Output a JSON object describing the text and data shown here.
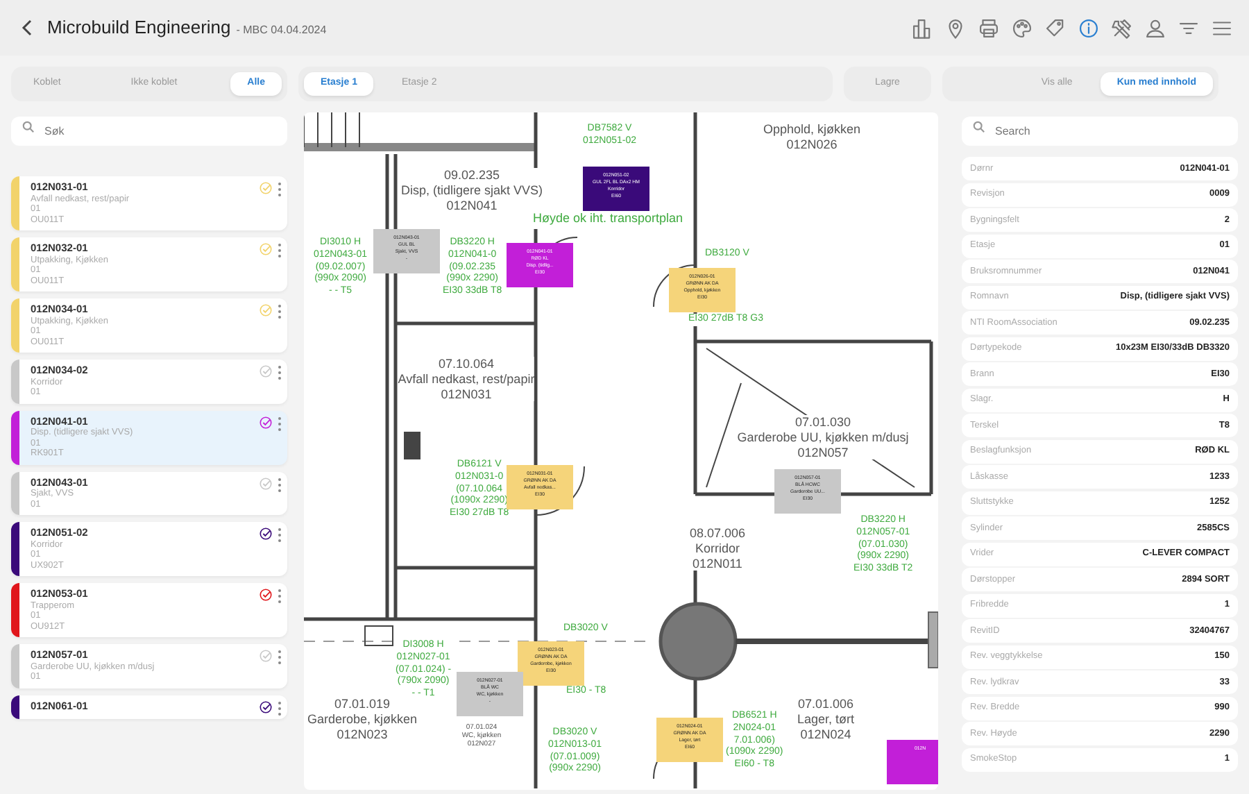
{
  "header": {
    "title": "Microbuild Engineering",
    "subtitle": "- MBC 04.04.2024"
  },
  "toolbar": [
    {
      "kind": "chart",
      "selected": false
    },
    {
      "kind": "pin",
      "selected": false
    },
    {
      "kind": "printer",
      "selected": false
    },
    {
      "kind": "palette",
      "selected": false
    },
    {
      "kind": "tag",
      "selected": false
    },
    {
      "kind": "info",
      "selected": true
    },
    {
      "kind": "tools",
      "selected": false
    },
    {
      "kind": "person",
      "selected": false
    },
    {
      "kind": "filter",
      "selected": false
    },
    {
      "kind": "menu",
      "selected": false
    }
  ],
  "link_filter": [
    {
      "label": "Koblet",
      "selected": false
    },
    {
      "label": "Ikke koblet",
      "selected": false
    },
    {
      "label": "Alle",
      "selected": true
    }
  ],
  "floors": [
    {
      "label": "Etasje 1",
      "selected": true
    },
    {
      "label": "Etasje 2",
      "selected": false
    }
  ],
  "save_button": "Lagre",
  "content_filter": [
    {
      "label": "Vis alle",
      "selected": false
    },
    {
      "label": "Kun med innhold",
      "selected": true
    }
  ],
  "door_list": {
    "search_placeholder": "Søk",
    "items": [
      {
        "id": "012N031-01",
        "name": "Avfall nedkast, rest/papir",
        "floor": "01",
        "code": "OU011T",
        "color": "#f2d36b",
        "selected": false
      },
      {
        "id": "012N032-01",
        "name": "Utpakking, Kjøkken",
        "floor": "01",
        "code": "OU011T",
        "color": "#f2d36b",
        "selected": false
      },
      {
        "id": "012N034-01",
        "name": "Utpakking, Kjøkken",
        "floor": "01",
        "code": "OU011T",
        "color": "#f2d36b",
        "selected": false
      },
      {
        "id": "012N034-02",
        "name": "Korridor",
        "floor": "01",
        "color": "#c8c8c8",
        "selected": false
      },
      {
        "id": "012N041-01",
        "name": "Disp. (tidligere sjakt VVS)",
        "floor": "01",
        "code": "RK901T",
        "color": "#c21fd8",
        "selected": true
      },
      {
        "id": "012N043-01",
        "name": "Sjakt, VVS",
        "floor": "01",
        "color": "#c8c8c8",
        "selected": false
      },
      {
        "id": "012N051-02",
        "name": "Korridor",
        "floor": "01",
        "code": "UX902T",
        "color": "#3a0a7a",
        "selected": false
      },
      {
        "id": "012N053-01",
        "name": "Trapperom",
        "floor": "01",
        "code": "OU912T",
        "color": "#e0161b",
        "selected": false
      },
      {
        "id": "012N057-01",
        "name": "Garderobe UU, kjøkken m/dusj",
        "floor": "01",
        "color": "#c8c8c8",
        "selected": false
      },
      {
        "id": "012N061-01",
        "color": "#3a0a7a",
        "selected": false
      }
    ]
  },
  "floor_plan": {
    "rooms": [
      {
        "lines": [
          "09.02.235",
          "Disp, (tidligere sjakt VVS)",
          "012N041"
        ]
      },
      {
        "lines": [
          "07.10.064",
          "Avfall nedkast, rest/papir",
          "012N031"
        ]
      },
      {
        "lines": [
          "Opphold, kjøkken",
          "012N026"
        ]
      },
      {
        "lines": [
          "07.01.030",
          "Garderobe UU, kjøkken m/dusj",
          "012N057"
        ]
      },
      {
        "lines": [
          "08.07.006",
          "Korridor",
          "012N011"
        ]
      },
      {
        "lines": [
          "07.01.019",
          "Garderobe, kjøkken",
          "012N023"
        ]
      },
      {
        "lines": [
          "07.01.006",
          "Lager, tørt",
          "012N024"
        ]
      },
      {
        "lines": [
          "07.01.024",
          "WC, kjøkken",
          "012N027"
        ]
      }
    ],
    "door_labels": [
      {
        "lines": [
          "DB7582 V",
          "012N051-02"
        ]
      },
      {
        "lines": [
          "DI3010 H",
          "012N043-01",
          "(09.02.007)",
          "(990x 2090)",
          "- - T5"
        ]
      },
      {
        "lines": [
          "DB3220 H",
          "012N041-0",
          "(09.02.235",
          "(990x 2290)",
          "EI30 33dB T8"
        ]
      },
      {
        "lines": [
          "DB3120 V"
        ]
      },
      {
        "lines": [
          "EI30 27dB T8 G3"
        ]
      },
      {
        "lines": [
          "DB6121 V",
          "012N031-0",
          "(07.10.064",
          "(1090x 2290)",
          "EI30 27dB T8"
        ]
      },
      {
        "lines": [
          "DB3220 H",
          "012N057-01",
          "(07.01.030)",
          "(990x 2290)",
          "EI30 33dB T2"
        ]
      },
      {
        "lines": [
          "DI3008 H",
          "012N027-01",
          "(07.01.024) -",
          "(790x 2090)",
          "- - T1"
        ]
      },
      {
        "lines": [
          "DB3020 V"
        ]
      },
      {
        "lines": [
          "EI30 - T8"
        ]
      },
      {
        "lines": [
          "DB3020 V",
          "012N013-01",
          "(07.01.009)",
          "(990x 2290)"
        ]
      },
      {
        "lines": [
          "DB6521 H",
          "2N024-01",
          "7.01.006)",
          "(1090x 2290)",
          "EI60 - T8"
        ]
      }
    ],
    "note": "Høyde ok iht. transportplan",
    "tags": [
      {
        "lines": [
          "012N051-02",
          "GUL 2FL BL DAx2 HM",
          "Korridor",
          "EI60"
        ],
        "color": "#3a0a7a"
      },
      {
        "lines": [
          "012N043-01",
          "GUL BL",
          "Sjakt, VVS",
          "-"
        ],
        "color": "#c8c8c8"
      },
      {
        "lines": [
          "012N041-01",
          "RØD KL",
          "Disp. (tidlig...",
          "EI30"
        ],
        "color": "#c21fd8"
      },
      {
        "lines": [
          "012N026-01",
          "GRØNN AK DA",
          "Opphold, kjøkken",
          "EI30"
        ],
        "color": "#f5d47a"
      },
      {
        "lines": [
          "012N031-01",
          "GRØNN AK DA",
          "Avfall nedkas...",
          "EI30"
        ],
        "color": "#f5d47a"
      },
      {
        "lines": [
          "012N057-01",
          "BLÅ HCWC",
          "Garderobe UU...",
          "EI30"
        ],
        "color": "#c8c8c8"
      },
      {
        "lines": [
          "012N023-01",
          "GRØNN AK DA",
          "Garderobe, kjøkken",
          "EI30"
        ],
        "color": "#f5d47a"
      },
      {
        "lines": [
          "012N027-01",
          "BLÅ WC",
          "WC, kjøkken",
          "-"
        ],
        "color": "#c8c8c8"
      },
      {
        "lines": [
          "012N024-01",
          "GRØNN AK DA",
          "Lager, tørt",
          "EI60"
        ],
        "color": "#f5d47a"
      },
      {
        "lines": [
          "012N"
        ],
        "color": "#c21fd8"
      }
    ]
  },
  "properties": {
    "search_placeholder": "Search",
    "rows": [
      {
        "label": "Dørnr",
        "value": "012N041-01"
      },
      {
        "label": "Revisjon",
        "value": "0009"
      },
      {
        "label": "Bygningsfelt",
        "value": "2"
      },
      {
        "label": "Etasje",
        "value": "01"
      },
      {
        "label": "Bruksromnummer",
        "value": "012N041"
      },
      {
        "label": "Romnavn",
        "value": "Disp, (tidligere sjakt VVS)"
      },
      {
        "label": "NTI RoomAssociation",
        "value": "09.02.235"
      },
      {
        "label": "Dørtypekode",
        "value": "10x23M EI30/33dB DB3320"
      },
      {
        "label": "Brann",
        "value": "EI30"
      },
      {
        "label": "Slagr.",
        "value": "H"
      },
      {
        "label": "Terskel",
        "value": "T8"
      },
      {
        "label": "Beslagfunksjon",
        "value": "RØD KL"
      },
      {
        "label": "Låskasse",
        "value": "1233"
      },
      {
        "label": "Sluttstykke",
        "value": "1252"
      },
      {
        "label": "Sylinder",
        "value": "2585CS"
      },
      {
        "label": "Vrider",
        "value": "C-LEVER COMPACT"
      },
      {
        "label": "Dørstopper",
        "value": "2894 SORT"
      },
      {
        "label": "Fribredde",
        "value": "1"
      },
      {
        "label": "RevitID",
        "value": "32404767"
      },
      {
        "label": "Rev. veggtykkelse",
        "value": "150"
      },
      {
        "label": "Rev. lydkrav",
        "value": "33"
      },
      {
        "label": "Rev. Bredde",
        "value": "990"
      },
      {
        "label": "Rev. Høyde",
        "value": "2290"
      },
      {
        "label": "SmokeStop",
        "value": "1"
      }
    ]
  }
}
